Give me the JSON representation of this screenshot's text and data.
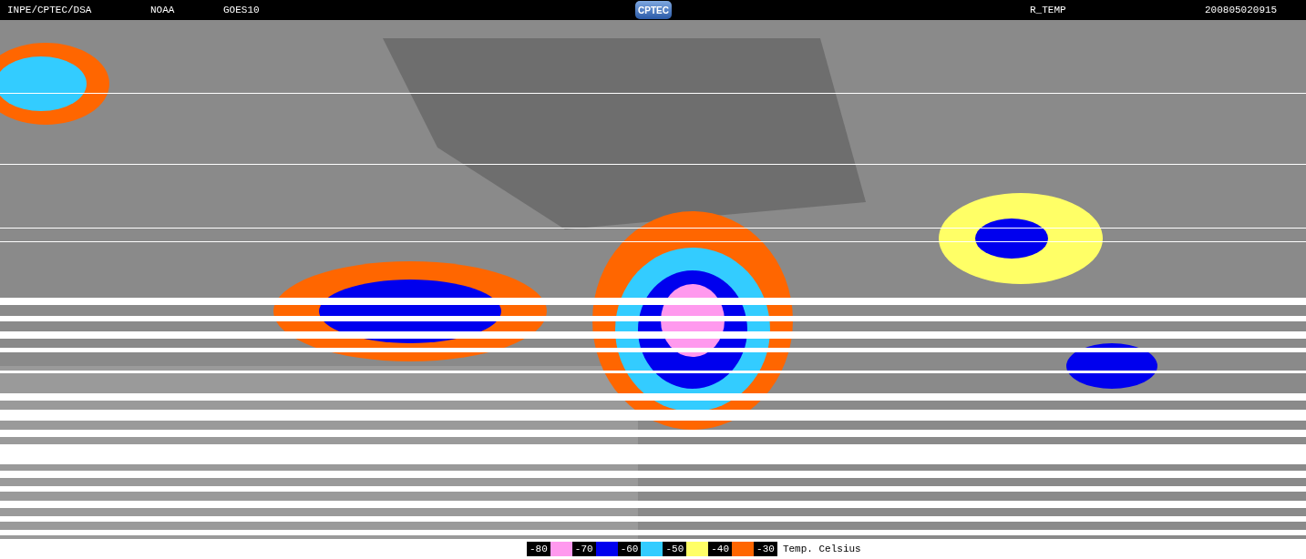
{
  "header": {
    "items": [
      {
        "kind": "text",
        "label": "INPE/CPTEC/DSA"
      },
      {
        "kind": "text",
        "label": "NOAA"
      },
      {
        "kind": "text",
        "label": "GOES10"
      },
      {
        "kind": "logo",
        "label": "CPTEC"
      },
      {
        "kind": "text",
        "label": "R_TEMP"
      },
      {
        "kind": "text",
        "label": "200805020915"
      }
    ]
  },
  "legend": {
    "items": [
      {
        "label": "-80",
        "color": "#ff99ee"
      },
      {
        "label": "-70",
        "color": "#0000ee"
      },
      {
        "label": "-60",
        "color": "#33ccff"
      },
      {
        "label": "-50",
        "color": "#ffff66"
      },
      {
        "label": "-40",
        "color": "#ff6600"
      },
      {
        "label": "-30"
      }
    ],
    "unit": "Temp. Celsius"
  }
}
